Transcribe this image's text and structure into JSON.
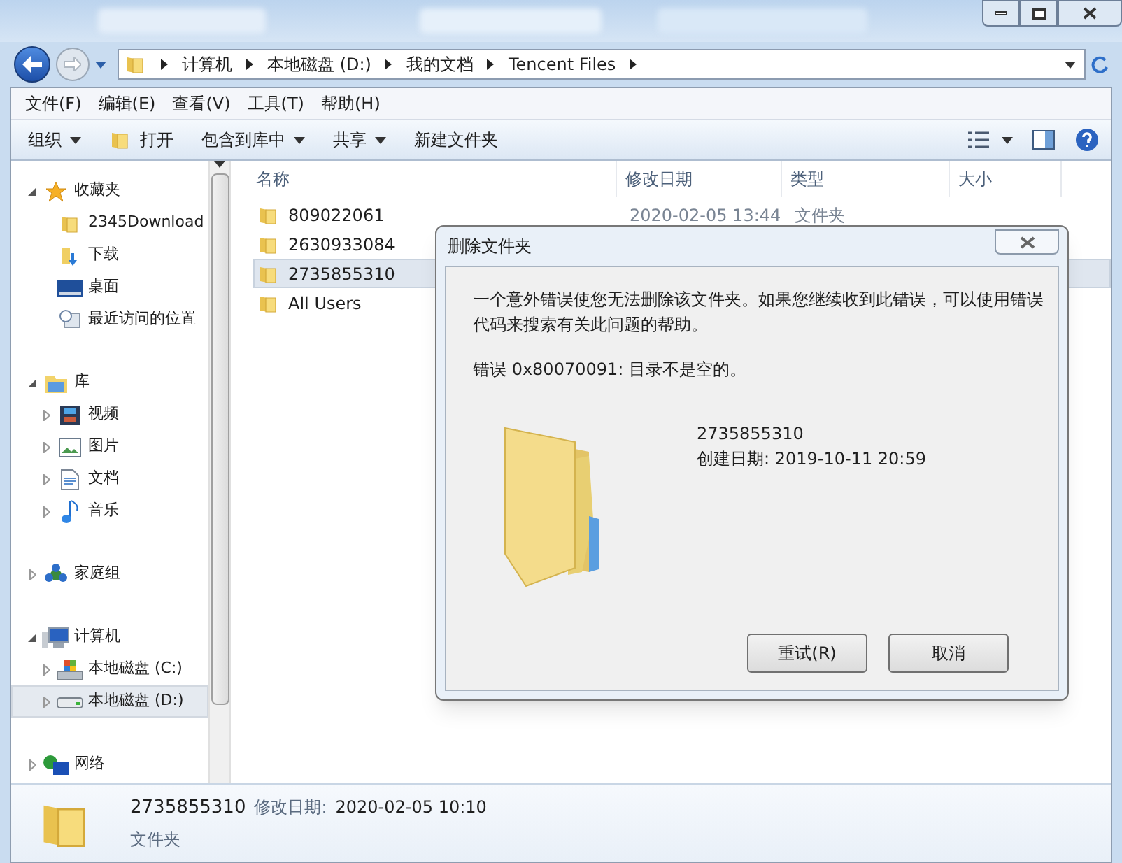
{
  "address": {
    "crumbs": [
      "计算机",
      "本地磁盘 (D:)",
      "我的文档",
      "Tencent Files"
    ]
  },
  "menu": [
    "文件(F)",
    "编辑(E)",
    "查看(V)",
    "工具(T)",
    "帮助(H)"
  ],
  "toolbar": [
    {
      "label": "组织",
      "kind": "menu"
    },
    {
      "label": "打开",
      "kind": "open"
    },
    {
      "label": "包含到库中",
      "kind": "menu"
    },
    {
      "label": "共享",
      "kind": "menu"
    },
    {
      "label": "新建文件夹",
      "kind": "plain"
    }
  ],
  "nav": [
    {
      "label": "收藏夹",
      "kind": "star",
      "expanded": true,
      "children": [
        {
          "label": "2345Download",
          "kind": "folder",
          "selected": false
        },
        {
          "label": "下载",
          "kind": "download",
          "selected": false
        },
        {
          "label": "桌面",
          "kind": "desktop",
          "selected": false
        },
        {
          "label": "最近访问的位置",
          "kind": "recent",
          "selected": false
        }
      ]
    },
    {
      "label": "库",
      "kind": "library",
      "expanded": true,
      "children": [
        {
          "label": "视频",
          "kind": "video",
          "expanded": false,
          "selected": false
        },
        {
          "label": "图片",
          "kind": "picture",
          "expanded": false,
          "selected": false
        },
        {
          "label": "文档",
          "kind": "document",
          "expanded": false,
          "selected": false
        },
        {
          "label": "音乐",
          "kind": "music",
          "expanded": false,
          "selected": false
        }
      ]
    },
    {
      "label": "家庭组",
      "kind": "homegroup",
      "expanded": false
    },
    {
      "label": "计算机",
      "kind": "computer",
      "expanded": true,
      "children": [
        {
          "label": "本地磁盘 (C:)",
          "kind": "drive_c",
          "expanded": false,
          "selected": false
        },
        {
          "label": "本地磁盘 (D:)",
          "kind": "drive",
          "expanded": false,
          "selected": true
        }
      ]
    },
    {
      "label": "网络",
      "kind": "network",
      "expanded": false
    }
  ],
  "files": {
    "columns": [
      "名称",
      "修改日期",
      "类型",
      "大小"
    ],
    "rows": [
      {
        "name": "809022061",
        "modified": "2020-02-05 13:44",
        "type": "文件夹",
        "selected": false
      },
      {
        "name": "2630933084",
        "selected": false
      },
      {
        "name": "2735855310",
        "selected": true
      },
      {
        "name": "All Users",
        "selected": false
      }
    ]
  },
  "dialog": {
    "title": "删除文件夹",
    "message": "一个意外错误使您无法删除该文件夹。如果您继续收到此错误，可以使用错误代码来搜索有关此问题的帮助。",
    "error": "错误 0x80070091: 目录不是空的。",
    "item_name": "2735855310",
    "item_created": "创建日期: 2019-10-11 20:59",
    "buttons": [
      "重试(R)",
      "取消"
    ]
  },
  "details": {
    "name": "2735855310",
    "modified_label": "修改日期:",
    "modified": "2020-02-05 10:10",
    "type": "文件夹"
  }
}
